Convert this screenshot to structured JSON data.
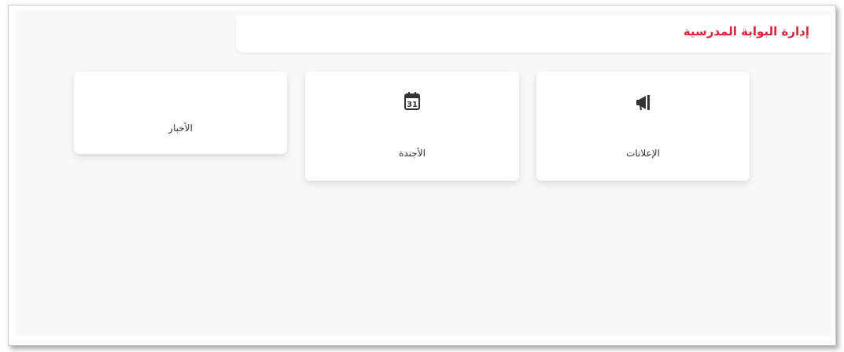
{
  "header": {
    "title": "إدارة البوابة المدرسية"
  },
  "cards": [
    {
      "label": "الإعلانات",
      "icon": "megaphone-icon"
    },
    {
      "label": "الأجندة",
      "icon": "calendar-icon",
      "icon_text": "31"
    },
    {
      "label": "الأخبار"
    }
  ],
  "colors": {
    "title": "#d3243b",
    "icon": "#333333",
    "panel_background": "#f8f8f8",
    "card_background": "#ffffff"
  }
}
